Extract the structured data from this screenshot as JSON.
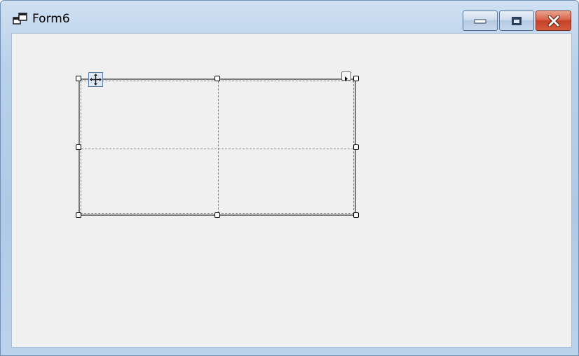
{
  "window": {
    "title": "Form6",
    "icon": "form-window-icon"
  },
  "caption_buttons": {
    "minimize_icon": "minimize-icon",
    "maximize_icon": "maximize-icon",
    "close_icon": "close-icon"
  },
  "designer": {
    "control": "table-layout-panel",
    "rows": 2,
    "columns": 2,
    "move_glyph_icon": "move-arrows-icon",
    "smart_tag_icon": "smart-tag-arrow-icon"
  },
  "colors": {
    "client_background": "#f0f0f0",
    "close_button": "#c6412a",
    "title_bar": "#b9d1ea"
  }
}
